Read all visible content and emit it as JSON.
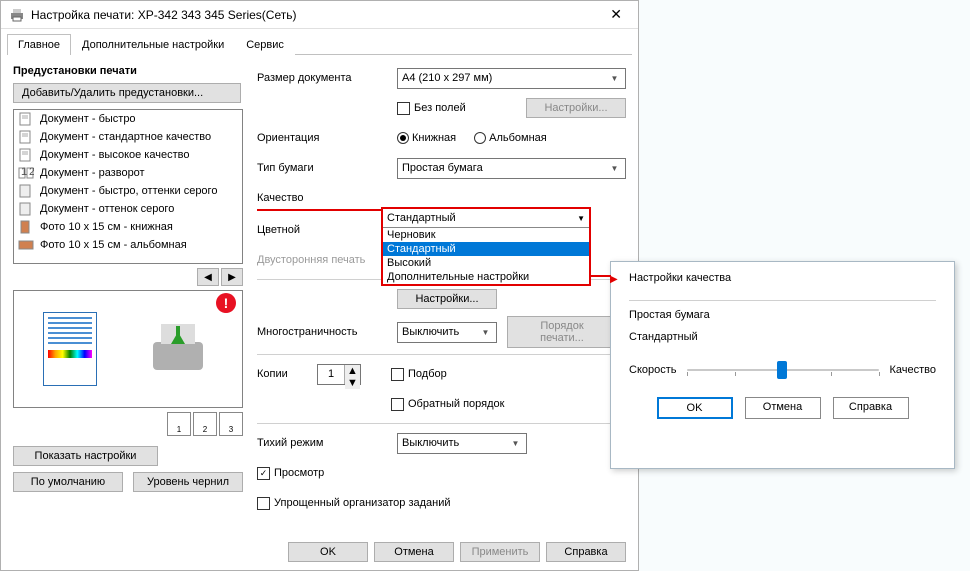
{
  "window": {
    "title": "Настройка печати: XP-342 343 345 Series(Сеть)"
  },
  "tabs": {
    "main": "Главное",
    "additional": "Дополнительные настройки",
    "service": "Сервис"
  },
  "presets": {
    "title": "Предустановки печати",
    "add_remove": "Добавить/Удалить предустановки...",
    "items": [
      "Документ - быстро",
      "Документ - стандартное качество",
      "Документ - высокое качество",
      "Документ - разворот",
      "Документ - быстро, оттенки серого",
      "Документ - оттенок серого",
      "Фото 10 x 15 см - книжная",
      "Фото 10 x 15 см - альбомная"
    ]
  },
  "left_buttons": {
    "show_settings": "Показать настройки",
    "defaults": "По умолчанию",
    "ink_levels": "Уровень чернил"
  },
  "form": {
    "doc_size_label": "Размер документа",
    "doc_size_value": "A4 (210 x 297 мм)",
    "borderless_label": "Без полей",
    "settings_btn": "Настройки...",
    "orientation_label": "Ориентация",
    "orientation_portrait": "Книжная",
    "orientation_landscape": "Альбомная",
    "paper_type_label": "Тип бумаги",
    "paper_type_value": "Простая бумага",
    "quality_label": "Качество",
    "quality_value": "Стандартный",
    "quality_options": [
      "Черновик",
      "Стандартный",
      "Высокий",
      "Дополнительные настройки"
    ],
    "color_label": "Цветной",
    "duplex_label": "Двусторонняя печать",
    "settings2_btn": "Настройки...",
    "multipage_label": "Многостраничность",
    "multipage_value": "Выключить",
    "page_order_btn": "Порядок печати...",
    "copies_label": "Копии",
    "copies_value": "1",
    "collate_label": "Подбор",
    "reverse_label": "Обратный порядок",
    "quiet_label": "Тихий режим",
    "quiet_value": "Выключить",
    "preview_label": "Просмотр",
    "simplified_label": "Упрощенный организатор заданий"
  },
  "bottom": {
    "ok": "OK",
    "cancel": "Отмена",
    "apply": "Применить",
    "help": "Справка"
  },
  "popup": {
    "title": "Настройки качества",
    "line1": "Простая бумага",
    "line2": "Стандартный",
    "speed": "Скорость",
    "quality": "Качество",
    "ok": "OK",
    "cancel": "Отмена",
    "help": "Справка"
  },
  "nav": {
    "left": "◀",
    "right": "▶"
  },
  "pagenums": [
    "1",
    "2",
    "3"
  ],
  "alert": "!"
}
